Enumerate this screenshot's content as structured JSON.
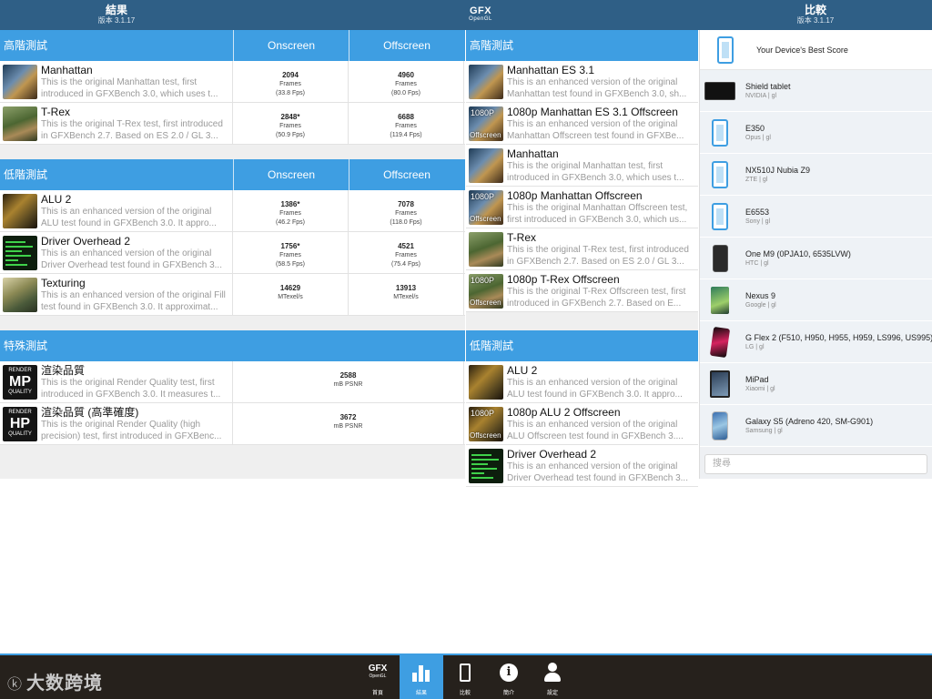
{
  "header": {
    "left_title": "結果",
    "left_version": "版本 3.1.17",
    "logo_main": "GFX",
    "logo_sub": "OpenGL",
    "right_title": "比較",
    "right_version": "版本 3.1.17"
  },
  "results": {
    "onscreen_label": "Onscreen",
    "offscreen_label": "Offscreen",
    "sections": [
      {
        "title": "高階測試",
        "rows": [
          {
            "title": "Manhattan",
            "desc1": "This is the original Manhattan test, first",
            "desc2": "introduced in GFXBench 3.0, which uses t...",
            "on_value": "2094",
            "on_unit": "Frames",
            "on_fps": "(33.8 Fps)",
            "off_value": "4960",
            "off_unit": "Frames",
            "off_fps": "(80.0 Fps)"
          },
          {
            "title": "T-Rex",
            "desc1": "This is the original T-Rex test, first introduced",
            "desc2": "in GFXBench 2.7. Based on ES 2.0 / GL 3...",
            "on_value": "2848*",
            "on_unit": "Frames",
            "on_fps": "(50.9 Fps)",
            "off_value": "6688",
            "off_unit": "Frames",
            "off_fps": "(119.4 Fps)"
          }
        ]
      },
      {
        "title": "低階測試",
        "rows": [
          {
            "title": "ALU 2",
            "desc1": "This is an enhanced version of the original",
            "desc2": "ALU test found in GFXBench 3.0. It appro...",
            "on_value": "1386*",
            "on_unit": "Frames",
            "on_fps": "(46.2 Fps)",
            "off_value": "7078",
            "off_unit": "Frames",
            "off_fps": "(118.0 Fps)"
          },
          {
            "title": "Driver Overhead 2",
            "desc1": "This is an enhanced version of the original",
            "desc2": "Driver Overhead test found in GFXBench 3...",
            "on_value": "1756*",
            "on_unit": "Frames",
            "on_fps": "(58.5 Fps)",
            "off_value": "4521",
            "off_unit": "Frames",
            "off_fps": "(75.4 Fps)"
          },
          {
            "title": "Texturing",
            "desc1": "This is an enhanced version of the original Fill",
            "desc2": "test found in GFXBench 3.0. It approximat...",
            "on_value": "14629",
            "on_unit": "MTexel/s",
            "off_value": "13913",
            "off_unit": "MTexel/s"
          }
        ]
      },
      {
        "title": "特殊測試",
        "rows": [
          {
            "title": "渲染品質",
            "desc1": "This is the original Render Quality test, first",
            "desc2": "introduced in GFXBench 3.0. It measures t...",
            "value": "2588",
            "unit": "mB PSNR",
            "badge_top": "RENDER",
            "badge_main": "MP",
            "badge_bottom": "QUALITY"
          },
          {
            "title": "渲染品質 (高準確度)",
            "desc1": "This is the original Render Quality (high",
            "desc2": "precision) test, first introduced in GFXBenc...",
            "value": "3672",
            "unit": "mB PSNR",
            "badge_top": "RENDER",
            "badge_main": "HP",
            "badge_bottom": "QUALITY"
          }
        ]
      }
    ]
  },
  "tests": {
    "sections": [
      {
        "title": "高階測試",
        "rows": [
          {
            "title": "Manhattan ES 3.1",
            "desc1": "This is an enhanced version of the original",
            "desc2": "Manhattan test found in GFXBench 3.0, sh..."
          },
          {
            "title": "1080p Manhattan ES 3.1 Offscreen",
            "desc1": "This is an enhanced version of the original",
            "desc2": "Manhattan Offscreen test found in GFXBe...",
            "badge1": "1080P",
            "badge2": "Offscreen"
          },
          {
            "title": "Manhattan",
            "desc1": "This is the original Manhattan test, first",
            "desc2": "introduced in GFXBench 3.0, which uses t..."
          },
          {
            "title": "1080p Manhattan Offscreen",
            "desc1": "This is the original Manhattan Offscreen test,",
            "desc2": "first introduced in GFXBench 3.0, which us...",
            "badge1": "1080P",
            "badge2": "Offscreen"
          },
          {
            "title": "T-Rex",
            "desc1": "This is the original T-Rex test, first introduced",
            "desc2": "in GFXBench 2.7. Based on ES 2.0 / GL 3..."
          },
          {
            "title": "1080p T-Rex Offscreen",
            "desc1": "This is the original T-Rex Offscreen test, first",
            "desc2": "introduced in GFXBench 2.7. Based on E...",
            "badge1": "1080P",
            "badge2": "Offscreen"
          }
        ]
      },
      {
        "title": "低階測試",
        "rows": [
          {
            "title": "ALU 2",
            "desc1": "This is an enhanced version of the original",
            "desc2": "ALU test found in GFXBench 3.0. It appro..."
          },
          {
            "title": "1080p ALU 2 Offscreen",
            "desc1": "This is an enhanced version of the original",
            "desc2": "ALU Offscreen test found in GFXBench 3....",
            "badge1": "1080P",
            "badge2": "Offscreen"
          },
          {
            "title": "Driver Overhead 2",
            "desc1": "This is an enhanced version of the original",
            "desc2": "Driver Overhead test found in GFXBench 3..."
          }
        ]
      }
    ]
  },
  "compare": {
    "best_label": "Your Device's Best Score",
    "devices": [
      {
        "name": "Shield tablet",
        "sub": "NVIDIA | gl",
        "icon": "tablet-icon"
      },
      {
        "name": "E350",
        "sub": "Opus | gl",
        "icon": "phone-outline-icon"
      },
      {
        "name": "NX510J Nubia Z9",
        "sub": "ZTE | gl",
        "icon": "phone-outline-icon"
      },
      {
        "name": "E6553",
        "sub": "Sony | gl",
        "icon": "phone-outline-icon"
      },
      {
        "name": "One M9 (0PJA10, 6535LVW)",
        "sub": "HTC | gl",
        "icon": "phone-icon"
      },
      {
        "name": "Nexus 9",
        "sub": "Google | gl",
        "icon": "tablet-icon"
      },
      {
        "name": "G Flex 2 (F510, H950, H955, H959, LS996, US995)",
        "sub": "LG | gl",
        "icon": "phone-icon"
      },
      {
        "name": "MiPad",
        "sub": "Xiaomi | gl",
        "icon": "tablet-icon"
      },
      {
        "name": "Galaxy S5 (Adreno 420, SM-G901)",
        "sub": "Samsung | gl",
        "icon": "phone-icon"
      }
    ],
    "search_placeholder": "搜尋"
  },
  "bottom": {
    "watermark": "大数跨境",
    "nav": [
      {
        "label": "首頁",
        "icon": "gfx-logo-icon"
      },
      {
        "label": "結果",
        "icon": "bar-chart-icon",
        "active": true
      },
      {
        "label": "比較",
        "icon": "phone-icon"
      },
      {
        "label": "簡介",
        "icon": "info-icon"
      },
      {
        "label": "設定",
        "icon": "user-icon"
      }
    ],
    "nav_logo_main": "GFX",
    "nav_logo_sub": "OpenGL"
  },
  "colors": {
    "header_bg": "#2f5f86",
    "section_header": "#3e9ee2",
    "bottom_bg": "#26211c",
    "active_tab": "#3e9ee2"
  }
}
